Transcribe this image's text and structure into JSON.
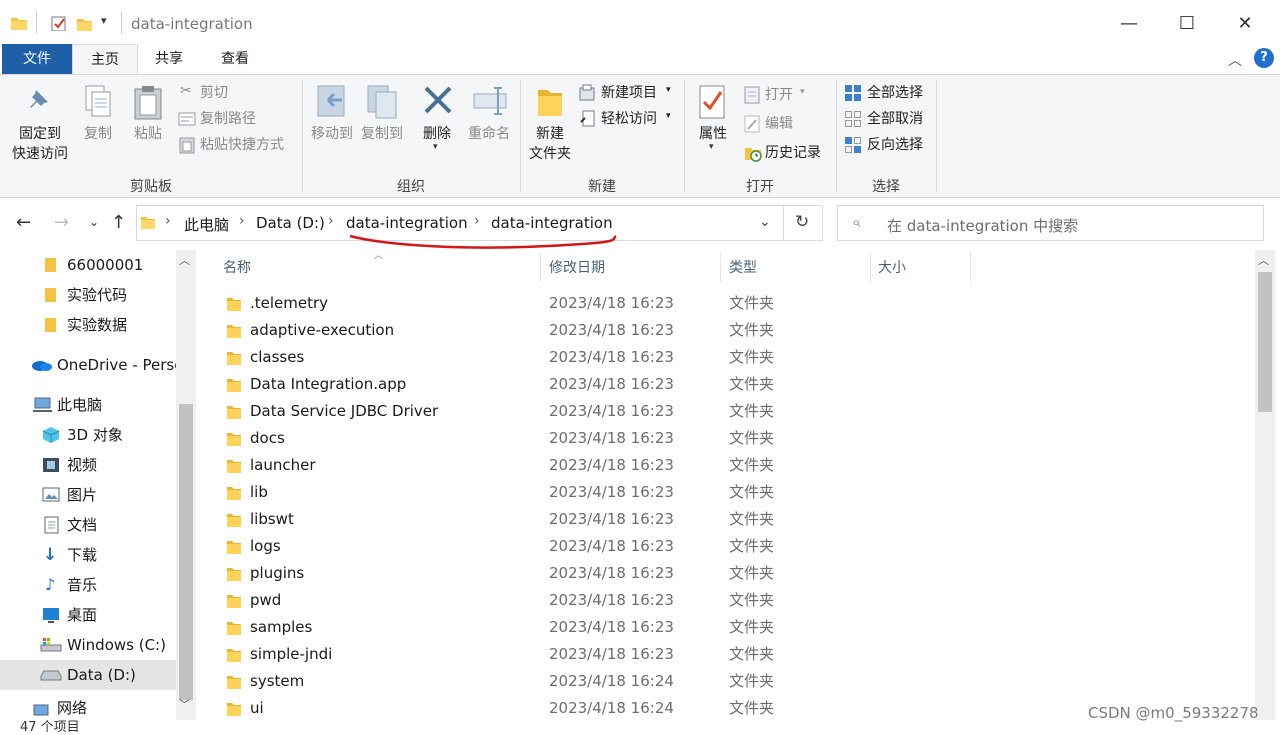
{
  "window": {
    "title": "data-integration"
  },
  "ribbon_tabs": [
    "文件",
    "主页",
    "共享",
    "查看"
  ],
  "ribbon": {
    "clipboard": {
      "group": "剪贴板",
      "pin_line1": "固定到",
      "pin_line2": "快速访问",
      "copy": "复制",
      "paste": "粘贴",
      "cut": "剪切",
      "copy_path": "复制路径",
      "paste_shortcut": "粘贴快捷方式"
    },
    "organize": {
      "group": "组织",
      "move_to": "移动到",
      "copy_to": "复制到",
      "delete": "删除",
      "rename": "重命名"
    },
    "new": {
      "group": "新建",
      "new_folder_line1": "新建",
      "new_folder_line2": "文件夹",
      "new_item": "新建项目",
      "easy_access": "轻松访问"
    },
    "open": {
      "group": "打开",
      "properties": "属性",
      "open": "打开",
      "edit": "编辑",
      "history": "历史记录"
    },
    "select": {
      "group": "选择",
      "select_all": "全部选择",
      "select_none": "全部取消",
      "invert": "反向选择"
    }
  },
  "address": {
    "crumbs": [
      "此电脑",
      "Data (D:)",
      "data-integration",
      "data-integration"
    ],
    "search_placeholder": "在 data-integration 中搜索"
  },
  "nav": {
    "items": [
      {
        "label": "66000001",
        "icon": "folder-icon"
      },
      {
        "label": "实验代码",
        "icon": "folder-icon"
      },
      {
        "label": "实验数据",
        "icon": "folder-icon"
      },
      {
        "label": "OneDrive - Persc",
        "icon": "onedrive-icon"
      },
      {
        "label": "此电脑",
        "icon": "computer-icon"
      },
      {
        "label": "3D 对象",
        "icon": "3d-objects-icon"
      },
      {
        "label": "视频",
        "icon": "video-icon"
      },
      {
        "label": "图片",
        "icon": "pictures-icon"
      },
      {
        "label": "文档",
        "icon": "documents-icon"
      },
      {
        "label": "下载",
        "icon": "download-icon"
      },
      {
        "label": "音乐",
        "icon": "music-icon"
      },
      {
        "label": "桌面",
        "icon": "desktop-icon"
      },
      {
        "label": "Windows (C:)",
        "icon": "drive-c-icon"
      },
      {
        "label": "Data (D:)",
        "icon": "drive-d-icon"
      },
      {
        "label": "网络",
        "icon": "network-icon"
      }
    ]
  },
  "columns": {
    "name": "名称",
    "date": "修改日期",
    "type": "类型",
    "size": "大小"
  },
  "files": [
    {
      "name": ".telemetry",
      "date": "2023/4/18 16:23",
      "type": "文件夹"
    },
    {
      "name": "adaptive-execution",
      "date": "2023/4/18 16:23",
      "type": "文件夹"
    },
    {
      "name": "classes",
      "date": "2023/4/18 16:23",
      "type": "文件夹"
    },
    {
      "name": "Data Integration.app",
      "date": "2023/4/18 16:23",
      "type": "文件夹"
    },
    {
      "name": "Data Service JDBC Driver",
      "date": "2023/4/18 16:23",
      "type": "文件夹"
    },
    {
      "name": "docs",
      "date": "2023/4/18 16:23",
      "type": "文件夹"
    },
    {
      "name": "launcher",
      "date": "2023/4/18 16:23",
      "type": "文件夹"
    },
    {
      "name": "lib",
      "date": "2023/4/18 16:23",
      "type": "文件夹"
    },
    {
      "name": "libswt",
      "date": "2023/4/18 16:23",
      "type": "文件夹"
    },
    {
      "name": "logs",
      "date": "2023/4/18 16:23",
      "type": "文件夹"
    },
    {
      "name": "plugins",
      "date": "2023/4/18 16:23",
      "type": "文件夹"
    },
    {
      "name": "pwd",
      "date": "2023/4/18 16:23",
      "type": "文件夹"
    },
    {
      "name": "samples",
      "date": "2023/4/18 16:23",
      "type": "文件夹"
    },
    {
      "name": "simple-jndi",
      "date": "2023/4/18 16:23",
      "type": "文件夹"
    },
    {
      "name": "system",
      "date": "2023/4/18 16:24",
      "type": "文件夹"
    },
    {
      "name": "ui",
      "date": "2023/4/18 16:24",
      "type": "文件夹"
    }
  ],
  "status": {
    "count": "47 个项目"
  },
  "watermark": "CSDN @m0_59332278",
  "colors": {
    "accent": "#1e5fa8",
    "folder": "#f5c342",
    "annotation": "#d01818"
  }
}
